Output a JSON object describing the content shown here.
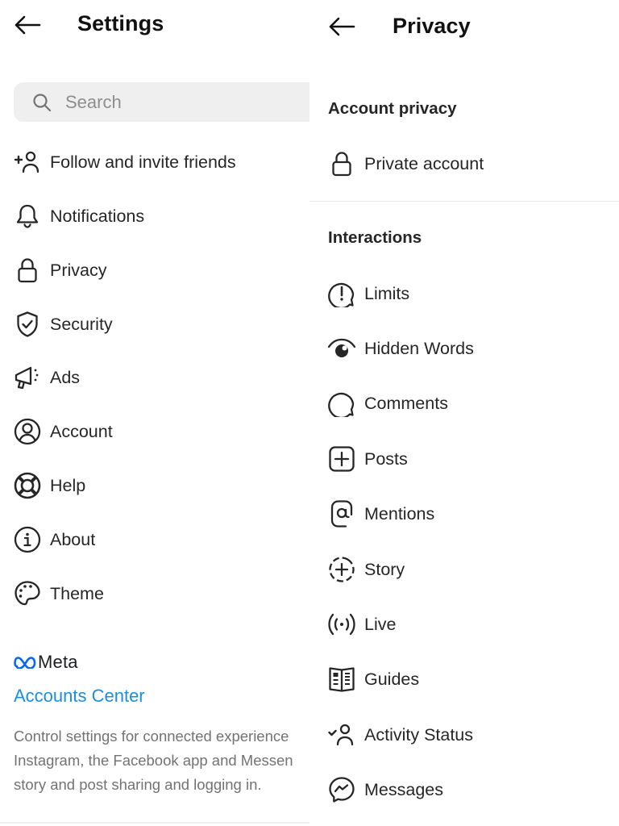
{
  "settings": {
    "title": "Settings",
    "back_icon": "arrow-left-icon",
    "search": {
      "placeholder": "Search",
      "value": "",
      "icon": "search-icon"
    },
    "items": [
      {
        "label": "Follow and invite friends",
        "icon": "add-person-icon"
      },
      {
        "label": "Notifications",
        "icon": "bell-icon"
      },
      {
        "label": "Privacy",
        "icon": "lock-icon"
      },
      {
        "label": "Security",
        "icon": "shield-check-icon"
      },
      {
        "label": "Ads",
        "icon": "megaphone-icon"
      },
      {
        "label": "Account",
        "icon": "account-circle-icon"
      },
      {
        "label": "Help",
        "icon": "lifebuoy-icon"
      },
      {
        "label": "About",
        "icon": "info-icon"
      },
      {
        "label": "Theme",
        "icon": "palette-icon"
      }
    ],
    "meta": {
      "brand": "Meta",
      "link": "Accounts Center",
      "description_lines": [
        "Control settings for connected experience",
        "Instagram, the Facebook app and Messen",
        "story and post sharing and logging in."
      ],
      "brand_color": "#0866ff",
      "link_color": "#1a8fdd"
    }
  },
  "privacy": {
    "title": "Privacy",
    "back_icon": "arrow-left-icon",
    "sections": {
      "account_privacy": {
        "title": "Account privacy",
        "items": [
          {
            "label": "Private account",
            "icon": "lock-icon"
          }
        ]
      },
      "interactions": {
        "title": "Interactions",
        "items": [
          {
            "label": "Limits",
            "icon": "limits-bubble-icon"
          },
          {
            "label": "Hidden Words",
            "icon": "hidden-eye-icon"
          },
          {
            "label": "Comments",
            "icon": "comment-bubble-icon"
          },
          {
            "label": "Posts",
            "icon": "plus-square-icon"
          },
          {
            "label": "Mentions",
            "icon": "at-sign-icon"
          },
          {
            "label": "Story",
            "icon": "story-add-icon"
          },
          {
            "label": "Live",
            "icon": "live-broadcast-icon"
          },
          {
            "label": "Guides",
            "icon": "guide-book-icon"
          },
          {
            "label": "Activity Status",
            "icon": "activity-person-icon"
          },
          {
            "label": "Messages",
            "icon": "messenger-icon"
          }
        ]
      }
    }
  }
}
